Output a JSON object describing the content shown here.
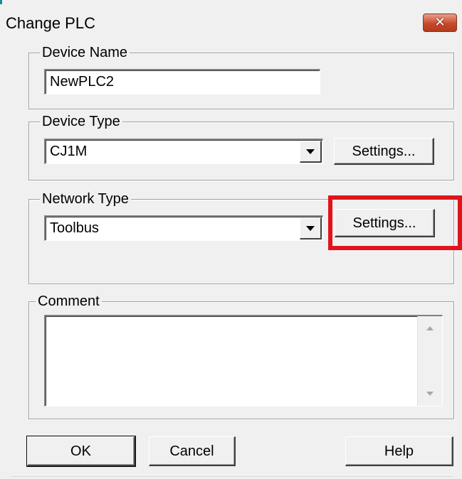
{
  "window": {
    "title": "Change PLC",
    "close_glyph": "✕"
  },
  "device_name": {
    "label": "Device Name",
    "value": "NewPLC2"
  },
  "device_type": {
    "label": "Device Type",
    "value": "CJ1M",
    "settings_label": "Settings..."
  },
  "network_type": {
    "label": "Network Type",
    "value": "Toolbus",
    "settings_label": "Settings..."
  },
  "comment": {
    "label": "Comment",
    "value": ""
  },
  "buttons": {
    "ok": "OK",
    "cancel": "Cancel",
    "help": "Help"
  },
  "colors": {
    "highlight": "#e0141c",
    "dialog_bg": "#f0f0f0",
    "close_button": "#c8482a"
  },
  "icons": {
    "close": "close-icon",
    "dropdown": "chevron-down-icon",
    "scroll_up": "scroll-up-arrow-icon",
    "scroll_down": "scroll-down-arrow-icon"
  }
}
